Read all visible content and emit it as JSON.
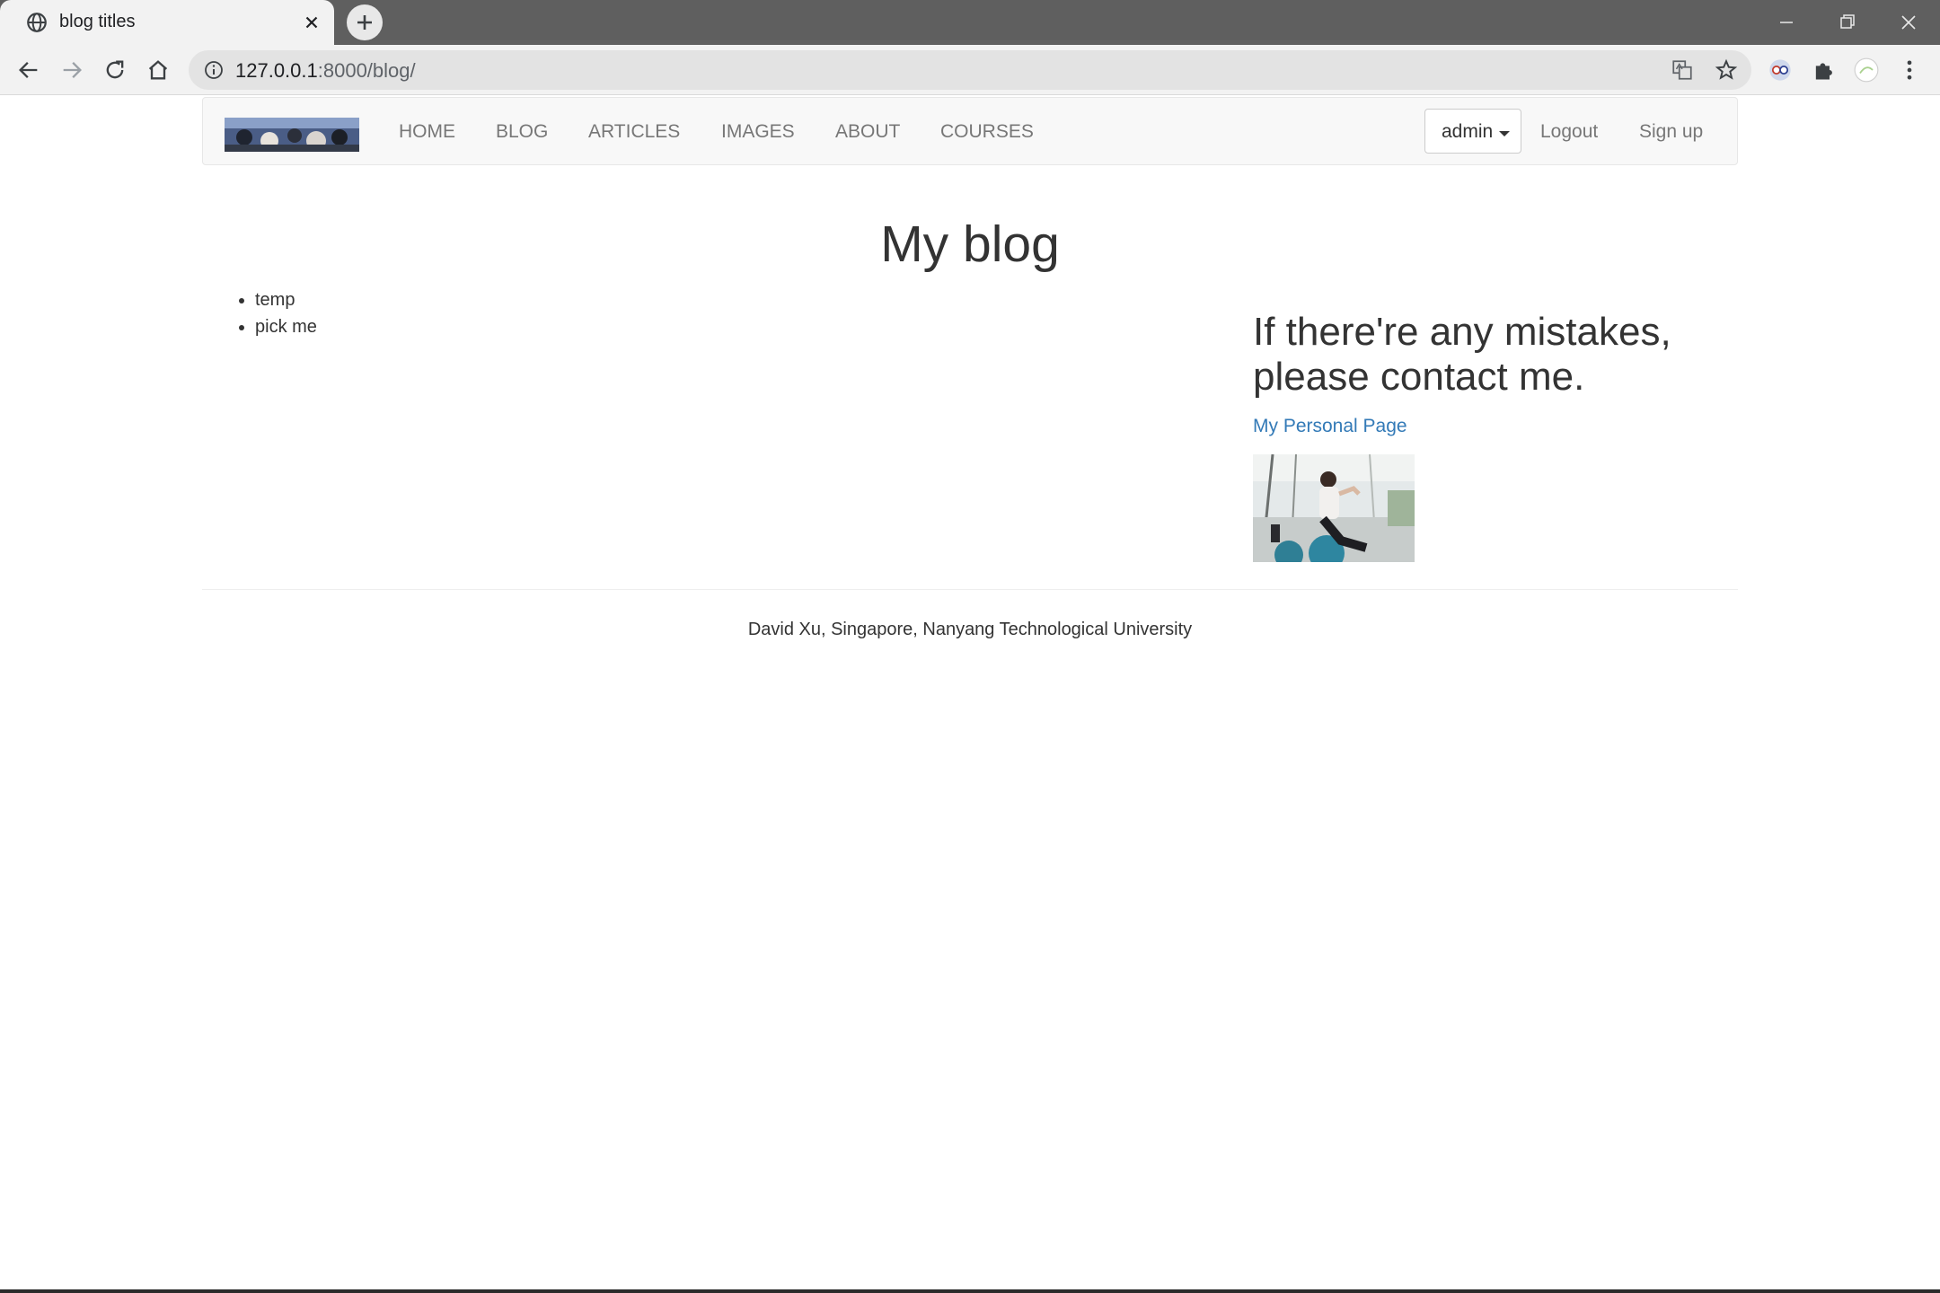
{
  "browser": {
    "tab_title": "blog titles",
    "url_host": "127.0.0.1",
    "url_rest": ":8000/blog/"
  },
  "navbar": {
    "links": [
      "HOME",
      "BLOG",
      "ARTICLES",
      "IMAGES",
      "ABOUT",
      "COURSES"
    ],
    "user_menu": "admin",
    "logout": "Logout",
    "signup": "Sign up"
  },
  "main": {
    "title": "My blog",
    "posts": [
      "temp",
      "pick me"
    ]
  },
  "sidebar": {
    "heading": "If there're any mistakes, please contact me.",
    "link_label": "My Personal Page"
  },
  "footer": {
    "text": "David Xu, Singapore, Nanyang Technological University"
  },
  "colors": {
    "link": "#337ab7",
    "navbar_bg": "#f8f8f8",
    "tabbar_bg": "#5f5f5f"
  }
}
